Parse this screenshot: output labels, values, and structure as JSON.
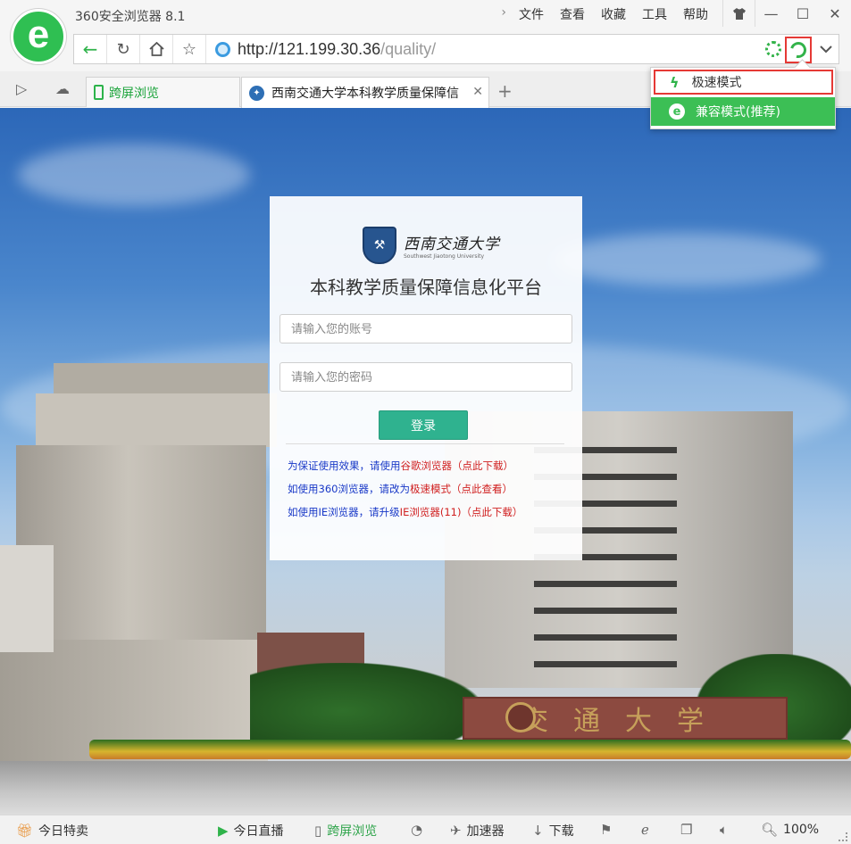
{
  "app": {
    "title": "360安全浏览器 8.1",
    "logo_letter": "e"
  },
  "menu": {
    "items": [
      "文件",
      "查看",
      "收藏",
      "工具",
      "帮助"
    ]
  },
  "window_controls": {
    "skin_icon": "shirt-icon",
    "minimize": "—",
    "maximize": "☐",
    "close": "✕"
  },
  "address_bar": {
    "url_host": "http://121.199.30.36",
    "url_path": "/quality/"
  },
  "tabs": [
    {
      "label": "跨屏浏览",
      "active": false
    },
    {
      "label": "西南交通大学本科教学质量保障信",
      "active": true
    }
  ],
  "mode_menu": {
    "speed_mode": "极速模式",
    "compat_mode": "兼容模式(推荐)"
  },
  "login": {
    "university_name": "西南交通大学",
    "university_name_en": "Southwest Jiaotong University",
    "platform_title": "本科教学质量保障信息化平台",
    "username_placeholder": "请输入您的账号",
    "password_placeholder": "请输入您的密码",
    "login_button": "登录",
    "notices": [
      {
        "text": "为保证使用效果，请使用",
        "link": "谷歌浏览器（点此下载）"
      },
      {
        "text": "如使用360浏览器，请改为",
        "link": "极速模式（点此查看）"
      },
      {
        "text": "如使用IE浏览器，请升级",
        "link": "IE浏览器(11)（点此下载）"
      }
    ]
  },
  "background": {
    "sign_text": "交通大学"
  },
  "status_bar": {
    "today_deals": "今日特卖",
    "today_live": "今日直播",
    "cross_screen": "跨屏浏览",
    "accelerator": "加速器",
    "download": "下载",
    "zoom": "100%"
  },
  "colors": {
    "brand_green": "#2fbf52",
    "login_button": "#2fb28f",
    "notice_blue": "#1838c7",
    "notice_red": "#d01f1f",
    "highlight_red": "#e53935"
  }
}
